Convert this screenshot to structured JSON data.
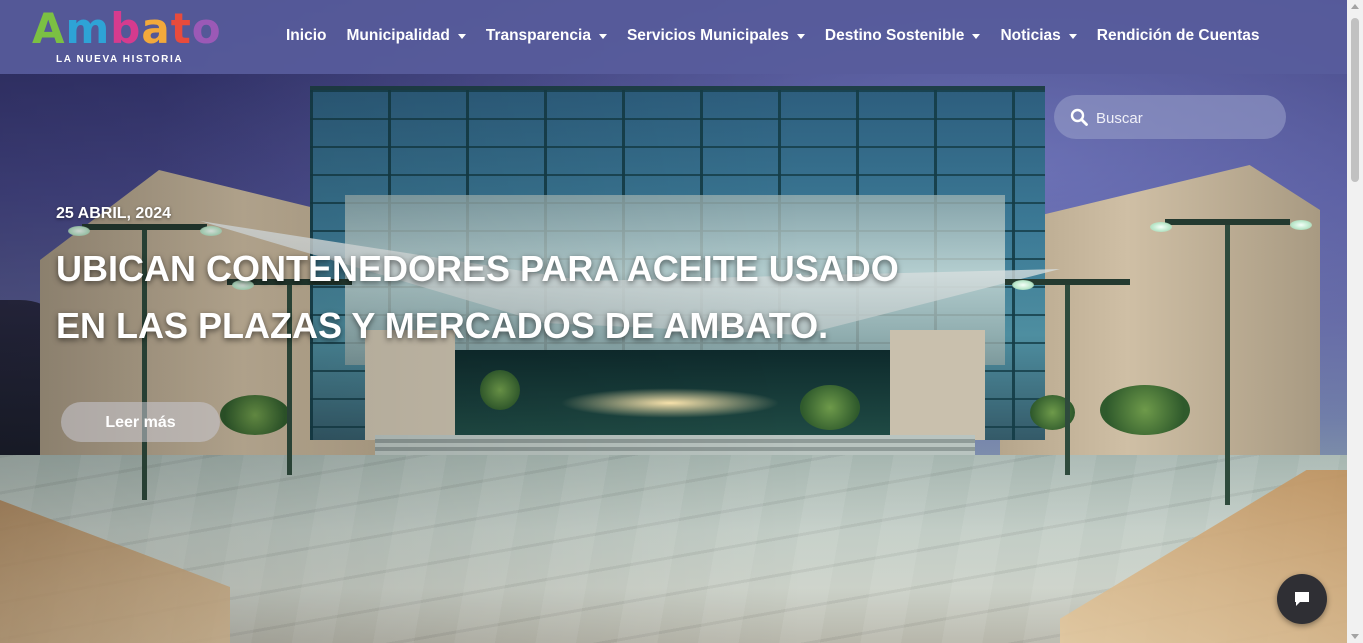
{
  "brand": {
    "logo_letters": [
      "A",
      "m",
      "b",
      "a",
      "t",
      "o"
    ],
    "tagline": "LA NUEVA HISTORIA"
  },
  "nav": [
    {
      "label": "Inicio",
      "dropdown": false
    },
    {
      "label": "Municipalidad",
      "dropdown": true
    },
    {
      "label": "Transparencia",
      "dropdown": true
    },
    {
      "label": "Servicios Municipales",
      "dropdown": true
    },
    {
      "label": "Destino Sostenible",
      "dropdown": true
    },
    {
      "label": "Noticias",
      "dropdown": true
    },
    {
      "label": "Rendición de Cuentas",
      "dropdown": false
    }
  ],
  "search": {
    "placeholder": "Buscar",
    "icon": "search-icon"
  },
  "hero": {
    "date": "25 ABRIL, 2024",
    "headline_line1": "UBICAN CONTENEDORES PARA ACEITE USADO",
    "headline_line2": "EN LAS PLAZAS Y MERCADOS DE AMBATO.",
    "cta_label": "Leer más"
  },
  "chat": {
    "icon": "chat-bubble-icon"
  },
  "colors": {
    "header_bg": "#585c9c",
    "text": "#ffffff",
    "chat_bg": "#2f2f34"
  }
}
